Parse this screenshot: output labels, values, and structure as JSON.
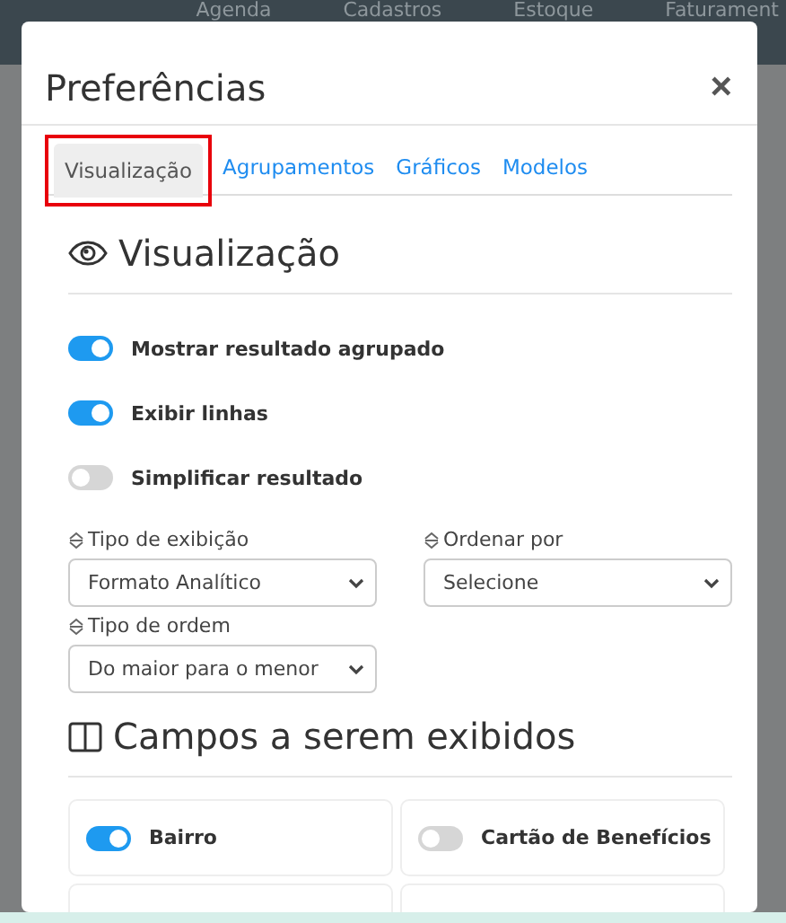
{
  "top_nav": {
    "items": [
      "Agenda",
      "Cadastros",
      "Estoque",
      "Faturament"
    ]
  },
  "modal": {
    "title": "Preferências",
    "close": "×",
    "tabs": [
      {
        "label": "Visualização",
        "selected": true,
        "highlighted": true
      },
      {
        "label": "Agrupamentos",
        "selected": false,
        "highlighted": false
      },
      {
        "label": "Gráficos",
        "selected": false,
        "highlighted": false
      },
      {
        "label": "Modelos",
        "selected": false,
        "highlighted": false
      }
    ],
    "view_section": {
      "heading": "Visualização",
      "toggles": [
        {
          "label": "Mostrar resultado agrupado",
          "on": true
        },
        {
          "label": "Exibir linhas",
          "on": true
        },
        {
          "label": "Simplificar resultado",
          "on": false
        }
      ],
      "selects": [
        {
          "label": "Tipo de exibição",
          "value": "Formato Analítico"
        },
        {
          "label": "Ordenar por",
          "value": "Selecione"
        },
        {
          "label": "Tipo de ordem",
          "value": "Do maior para o menor"
        }
      ]
    },
    "fields_section": {
      "heading": "Campos a serem exibidos",
      "fields": [
        {
          "label": "Bairro",
          "on": true
        },
        {
          "label": "Cartão de Benefícios",
          "on": false
        }
      ]
    }
  }
}
